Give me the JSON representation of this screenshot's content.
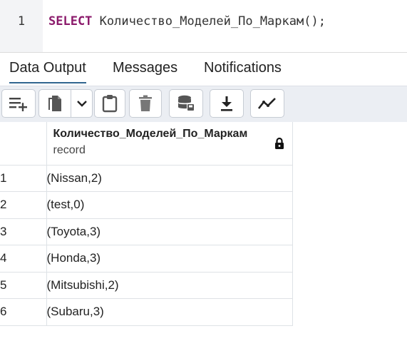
{
  "editor": {
    "line_number": "1",
    "keyword": "SELECT",
    "rest": " Количество_Моделей_По_Маркам();"
  },
  "tabs": [
    {
      "label": "Data Output",
      "active": true
    },
    {
      "label": "Messages",
      "active": false
    },
    {
      "label": "Notifications",
      "active": false
    }
  ],
  "toolbar": {
    "buttons": [
      {
        "icon": "add-row-icon"
      },
      {
        "icon": "copy-icon"
      },
      {
        "icon": "chevron-down-icon"
      },
      {
        "icon": "paste-icon"
      },
      {
        "icon": "delete-icon"
      },
      {
        "icon": "save-data-icon"
      },
      {
        "icon": "download-icon"
      },
      {
        "icon": "graph-icon"
      }
    ]
  },
  "grid": {
    "column": {
      "name": "Количество_Моделей_По_Маркам",
      "type": "record",
      "icon": "lock-icon"
    },
    "rows": [
      {
        "num": "1",
        "value": "(Nissan,2)"
      },
      {
        "num": "2",
        "value": "(test,0)"
      },
      {
        "num": "3",
        "value": "(Toyota,3)"
      },
      {
        "num": "4",
        "value": "(Honda,3)"
      },
      {
        "num": "5",
        "value": "(Mitsubishi,2)"
      },
      {
        "num": "6",
        "value": "(Subaru,3)"
      }
    ]
  }
}
